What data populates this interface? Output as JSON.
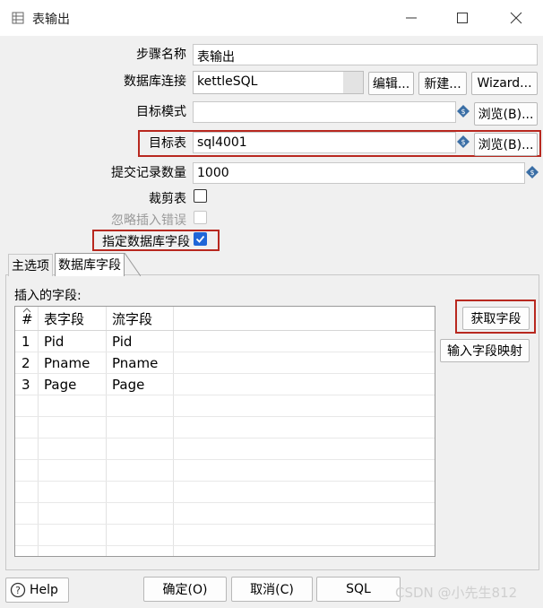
{
  "window": {
    "title": "表输出"
  },
  "form": {
    "step_name_label": "步骤名称",
    "step_name_value": "表输出",
    "connection_label": "数据库连接",
    "connection_value": "kettleSQL",
    "edit_button": "编辑...",
    "new_button": "新建...",
    "wizard_button": "Wizard...",
    "schema_label": "目标模式",
    "schema_value": "",
    "browse_schema_button": "浏览(B)...",
    "table_label": "目标表",
    "table_value": "sql4001",
    "browse_table_button": "浏览(B)...",
    "commit_size_label": "提交记录数量",
    "commit_size_value": "1000",
    "truncate_label": "裁剪表",
    "truncate_checked": false,
    "ignore_errors_label": "忽略插入错误",
    "ignore_errors_checked": false,
    "specify_fields_label": "指定数据库字段",
    "specify_fields_checked": true
  },
  "tabs": [
    {
      "label": "主选项",
      "active": false
    },
    {
      "label": "数据库字段",
      "active": true
    }
  ],
  "fields_panel": {
    "label": "插入的字段:",
    "columns": [
      "#",
      "表字段",
      "流字段"
    ],
    "rows": [
      [
        "1",
        "Pid",
        "Pid"
      ],
      [
        "2",
        "Pname",
        "Pname"
      ],
      [
        "3",
        "Page",
        "Page"
      ]
    ],
    "get_fields_button": "获取字段",
    "mapping_button": "输入字段映射"
  },
  "footer": {
    "help_button": "Help",
    "ok_button": "确定(O)",
    "cancel_button": "取消(C)",
    "sql_button": "SQL"
  },
  "watermark": "CSDN @小先生812",
  "colors": {
    "highlight": "#b8281f",
    "checkbox": "#1f66d8",
    "variable_icon": "#3a6ea5"
  }
}
